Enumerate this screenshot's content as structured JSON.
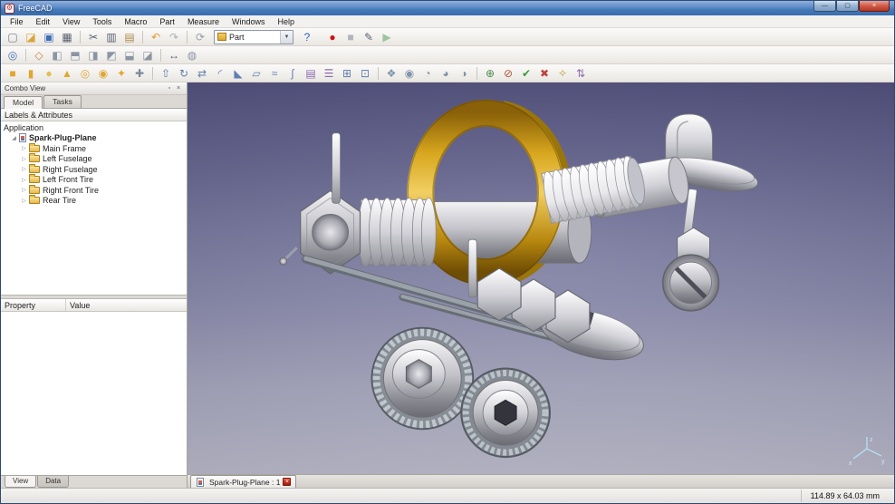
{
  "window": {
    "title": "FreeCAD"
  },
  "titlebar": {
    "minimize_glyph": "—",
    "maximize_glyph": "▢",
    "close_glyph": "×"
  },
  "menu": {
    "items": [
      {
        "name": "menu-file",
        "label": "File"
      },
      {
        "name": "menu-edit",
        "label": "Edit"
      },
      {
        "name": "menu-view",
        "label": "View"
      },
      {
        "name": "menu-tools",
        "label": "Tools"
      },
      {
        "name": "menu-macro",
        "label": "Macro"
      },
      {
        "name": "menu-part",
        "label": "Part"
      },
      {
        "name": "menu-measure",
        "label": "Measure"
      },
      {
        "name": "menu-windows",
        "label": "Windows"
      },
      {
        "name": "menu-help",
        "label": "Help"
      }
    ]
  },
  "toolbar1": {
    "file_icons": [
      {
        "name": "new-document-icon",
        "glyph": "▢",
        "color": "#6b7687"
      },
      {
        "name": "open-document-icon",
        "glyph": "◪",
        "color": "#d9a43a"
      },
      {
        "name": "save-icon",
        "glyph": "▣",
        "color": "#3d6db5"
      },
      {
        "name": "print-icon",
        "glyph": "▦",
        "color": "#5a6270"
      },
      {
        "name": "separator",
        "glyph": "",
        "color": "",
        "cls": "sep"
      },
      {
        "name": "cut-icon",
        "glyph": "✂",
        "color": "#5a6270"
      },
      {
        "name": "copy-icon",
        "glyph": "▥",
        "color": "#5a6270"
      },
      {
        "name": "paste-icon",
        "glyph": "▤",
        "color": "#b08a4a"
      },
      {
        "name": "separator",
        "glyph": "",
        "color": "",
        "cls": "sep"
      },
      {
        "name": "undo-icon",
        "glyph": "↶",
        "color": "#e09a2a"
      },
      {
        "name": "redo-icon",
        "glyph": "↷",
        "color": "#aab0b8"
      },
      {
        "name": "separator",
        "glyph": "",
        "color": "",
        "cls": "sep"
      },
      {
        "name": "refresh-icon",
        "glyph": "⟳",
        "color": "#9aa0a8"
      }
    ],
    "workbench_value": "Part",
    "chevron_glyph": "▼",
    "help_icons": [
      {
        "name": "whats-this-icon",
        "glyph": "?",
        "color": "#2d62c8"
      }
    ],
    "macro_icons": [
      {
        "name": "macro-record-icon",
        "glyph": "●",
        "color": "#cc1111"
      },
      {
        "name": "macro-stop-icon",
        "glyph": "■",
        "color": "#b0b4ba"
      },
      {
        "name": "macro-edit-icon",
        "glyph": "✎",
        "color": "#5a6270"
      },
      {
        "name": "macro-play-icon",
        "glyph": "▶",
        "color": "#9ec49e"
      }
    ]
  },
  "toolbar2": {
    "icons": [
      {
        "name": "fit-all-icon",
        "glyph": "◎",
        "color": "#3d6db5"
      },
      {
        "name": "separator",
        "glyph": "",
        "color": "",
        "cls": "sep"
      },
      {
        "name": "axonometric-view-icon",
        "glyph": "◇",
        "color": "#c2843a"
      },
      {
        "name": "front-view-icon",
        "glyph": "◧",
        "color": "#8a94a4"
      },
      {
        "name": "top-view-icon",
        "glyph": "⬒",
        "color": "#8a94a4"
      },
      {
        "name": "right-view-icon",
        "glyph": "◨",
        "color": "#8a94a4"
      },
      {
        "name": "rear-view-icon",
        "glyph": "◩",
        "color": "#8a94a4"
      },
      {
        "name": "bottom-view-icon",
        "glyph": "⬓",
        "color": "#8a94a4"
      },
      {
        "name": "left-view-icon",
        "glyph": "◪",
        "color": "#8a94a4"
      },
      {
        "name": "separator",
        "glyph": "",
        "color": "",
        "cls": "sep"
      },
      {
        "name": "measure-distance-icon",
        "glyph": "↔",
        "color": "#5a6270"
      },
      {
        "name": "draw-style-icon",
        "glyph": "◍",
        "color": "#8a94a4"
      }
    ]
  },
  "toolbar3": {
    "icons": [
      {
        "name": "box-primitive-icon",
        "glyph": "■",
        "color": "#dfa733"
      },
      {
        "name": "cylinder-primitive-icon",
        "glyph": "▮",
        "color": "#dfa733"
      },
      {
        "name": "sphere-primitive-icon",
        "glyph": "●",
        "color": "#e3bc4e"
      },
      {
        "name": "cone-primitive-icon",
        "glyph": "▲",
        "color": "#dfa733"
      },
      {
        "name": "torus-primitive-icon",
        "glyph": "◎",
        "color": "#dfa733"
      },
      {
        "name": "tube-primitive-icon",
        "glyph": "◉",
        "color": "#dfa733"
      },
      {
        "name": "create-primitives-icon",
        "glyph": "✦",
        "color": "#dfa733"
      },
      {
        "name": "shape-builder-icon",
        "glyph": "✚",
        "color": "#7a8a9a"
      },
      {
        "name": "separator",
        "glyph": "",
        "color": "",
        "cls": "sep"
      },
      {
        "name": "extrude-icon",
        "glyph": "⇧",
        "color": "#5f7fb0"
      },
      {
        "name": "revolve-icon",
        "glyph": "↻",
        "color": "#5f7fb0"
      },
      {
        "name": "mirror-icon",
        "glyph": "⇄",
        "color": "#5f7fb0"
      },
      {
        "name": "fillet-icon",
        "glyph": "◜",
        "color": "#5f7fb0"
      },
      {
        "name": "chamfer-icon",
        "glyph": "◣",
        "color": "#5f7fb0"
      },
      {
        "name": "ruled-surface-icon",
        "glyph": "▱",
        "color": "#5f7fb0"
      },
      {
        "name": "loft-icon",
        "glyph": "≈",
        "color": "#5f7fb0"
      },
      {
        "name": "sweep-icon",
        "glyph": "∫",
        "color": "#5f7fb0"
      },
      {
        "name": "section-icon",
        "glyph": "▤",
        "color": "#8a6ab0"
      },
      {
        "name": "cross-sections-icon",
        "glyph": "☰",
        "color": "#8a6ab0"
      },
      {
        "name": "offset-icon",
        "glyph": "⊞",
        "color": "#5f7fb0"
      },
      {
        "name": "thickness-icon",
        "glyph": "⊡",
        "color": "#5f7fb0"
      },
      {
        "name": "separator",
        "glyph": "",
        "color": "",
        "cls": "sep"
      },
      {
        "name": "compound-icon",
        "glyph": "❖",
        "color": "#7f93ab"
      },
      {
        "name": "boolean-icon",
        "glyph": "◉",
        "color": "#7f93ab"
      },
      {
        "name": "cut-boolean-icon",
        "glyph": "◔",
        "color": "#7f93ab"
      },
      {
        "name": "union-icon",
        "glyph": "◕",
        "color": "#7f93ab"
      },
      {
        "name": "intersection-icon",
        "glyph": "◑",
        "color": "#7f93ab"
      },
      {
        "name": "separator",
        "glyph": "",
        "color": "",
        "cls": "sep"
      },
      {
        "name": "join-connect-icon",
        "glyph": "⊕",
        "color": "#4a8a4a"
      },
      {
        "name": "split-icon",
        "glyph": "⊘",
        "color": "#b0563a"
      },
      {
        "name": "check-geometry-icon",
        "glyph": "✔",
        "color": "#3a9a3a"
      },
      {
        "name": "defeaturing-icon",
        "glyph": "✖",
        "color": "#c04040"
      },
      {
        "name": "refine-shape-icon",
        "glyph": "✧",
        "color": "#c09a3a"
      },
      {
        "name": "convert-icon",
        "glyph": "⇅",
        "color": "#8a6ab0"
      }
    ]
  },
  "combo_view": {
    "title": "Combo View",
    "float_glyph": "▫",
    "close_glyph": "×",
    "tabs": [
      {
        "name": "tab-model",
        "label": "Model",
        "active": true
      },
      {
        "name": "tab-tasks",
        "label": "Tasks",
        "active": false
      }
    ],
    "labels_header": "Labels & Attributes",
    "application_label": "Application",
    "root_item": {
      "label": "Spark-Plug-Plane",
      "expander": "◢"
    },
    "tree_items": [
      {
        "label": "Main Frame",
        "arrow": "▷"
      },
      {
        "label": "Left Fuselage",
        "arrow": "▷"
      },
      {
        "label": "Right Fuselage",
        "arrow": "▷"
      },
      {
        "label": "Left Front Tire",
        "arrow": "▷"
      },
      {
        "label": "Right Front Tire",
        "arrow": "▷"
      },
      {
        "label": "Rear Tire",
        "arrow": "▷"
      }
    ],
    "property_columns": {
      "property": "Property",
      "value": "Value"
    },
    "bottom_tabs": [
      {
        "name": "tab-view",
        "label": "View",
        "active": true
      },
      {
        "name": "tab-data",
        "label": "Data",
        "active": false
      }
    ]
  },
  "document_tab": {
    "label": "Spark-Plug-Plane : 1",
    "close_glyph": "×"
  },
  "viewport": {
    "axis": {
      "x": "x",
      "y": "y",
      "z": "z"
    }
  },
  "status_bar": {
    "dimensions": "114.89 x 64.03 mm"
  }
}
